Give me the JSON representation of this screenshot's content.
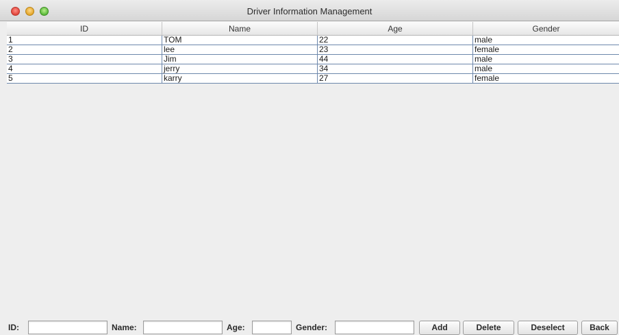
{
  "window": {
    "title": "Driver Information Management"
  },
  "table": {
    "columns": [
      "ID",
      "Name",
      "Age",
      "Gender"
    ],
    "rows": [
      [
        "1",
        "TOM",
        "22",
        "male"
      ],
      [
        "2",
        "lee",
        "23",
        "female"
      ],
      [
        "3",
        "Jim",
        "44",
        "male"
      ],
      [
        "4",
        "jerry",
        "34",
        "male"
      ],
      [
        "5",
        "karry",
        "27",
        "female"
      ]
    ]
  },
  "form": {
    "id_label": "ID:",
    "id_value": "",
    "name_label": "Name:",
    "name_value": "",
    "age_label": "Age:",
    "age_value": "",
    "gender_label": "Gender:",
    "gender_value": "",
    "add_label": "Add",
    "delete_label": "Delete",
    "deselect_label": "Deselect",
    "back_label": "Back"
  },
  "colors": {
    "window_bg": "#eeeeee",
    "grid_line": "#6c87ab",
    "close": "#e0443a",
    "minimize": "#e3a62a",
    "maximize": "#5ab93a"
  }
}
